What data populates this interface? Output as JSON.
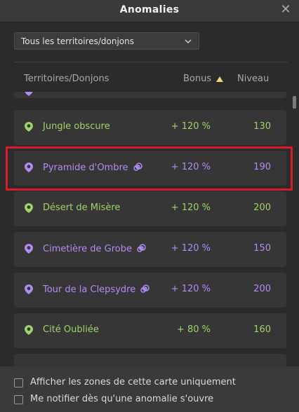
{
  "window": {
    "title": "Anomalies",
    "close_icon": "close-icon"
  },
  "filter": {
    "selected": "Tous les territoires/donjons"
  },
  "table": {
    "headers": {
      "name": "Territoires/Donjons",
      "bonus": "Bonus",
      "level": "Niveau"
    },
    "sort": {
      "column": "bonus",
      "direction": "ascending"
    },
    "rows": [
      {
        "name": "",
        "bonus": "",
        "level": "",
        "type": "donjon",
        "partial": true
      },
      {
        "name": "Jungle obscure",
        "bonus": "+ 120 %",
        "level": "130",
        "type": "territoire"
      },
      {
        "name": "Pyramide d'Ombre",
        "bonus": "+ 120 %",
        "level": "190",
        "type": "donjon",
        "highlighted": true
      },
      {
        "name": "Désert de Misère",
        "bonus": "+ 120 %",
        "level": "200",
        "type": "territoire"
      },
      {
        "name": "Cimetière de Grobe",
        "bonus": "+ 120 %",
        "level": "150",
        "type": "donjon"
      },
      {
        "name": "Tour de la Clepsydre",
        "bonus": "+ 120 %",
        "level": "200",
        "type": "donjon"
      },
      {
        "name": "Cité Oubliée",
        "bonus": "+ 80 %",
        "level": "160",
        "type": "territoire"
      },
      {
        "name": "",
        "bonus": "",
        "level": "",
        "type": "territoire",
        "partial": true
      }
    ]
  },
  "options": {
    "map_only": {
      "label": "Afficher les zones de cette carte uniquement",
      "checked": false
    },
    "notify": {
      "label": "Me notifier dès qu'une anomalie s'ouvre",
      "checked": false
    }
  },
  "colors": {
    "territoire": "#9ed36a",
    "donjon": "#b08cf3",
    "highlight_border": "#d71b2b",
    "sort_arrow": "#f0d27a"
  }
}
